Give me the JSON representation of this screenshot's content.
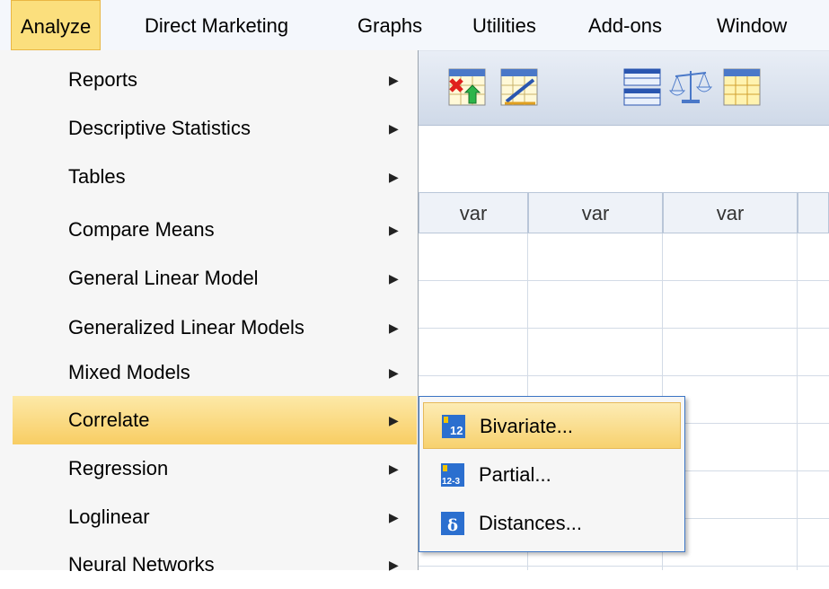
{
  "menubar": {
    "items": [
      {
        "label": "Analyze",
        "active": true
      },
      {
        "label": "Direct Marketing"
      },
      {
        "label": "Graphs"
      },
      {
        "label": "Utilities"
      },
      {
        "label": "Add-ons"
      },
      {
        "label": "Window"
      }
    ]
  },
  "grid": {
    "columns": [
      "var",
      "var",
      "var"
    ]
  },
  "analyze_menu": {
    "items": [
      {
        "label": "Reports"
      },
      {
        "label": "Descriptive Statistics"
      },
      {
        "label": "Tables"
      },
      {
        "label": "Compare Means"
      },
      {
        "label": "General Linear Model"
      },
      {
        "label": "Generalized Linear Models"
      },
      {
        "label": "Mixed Models"
      },
      {
        "label": "Correlate",
        "highlighted": true
      },
      {
        "label": "Regression"
      },
      {
        "label": "Loglinear"
      },
      {
        "label": "Neural Networks"
      }
    ],
    "arrow": "▶"
  },
  "correlate_submenu": {
    "items": [
      {
        "label": "Bivariate...",
        "icon": "bivariate-icon",
        "highlighted": true
      },
      {
        "label": "Partial...",
        "icon": "partial-icon"
      },
      {
        "label": "Distances...",
        "icon": "distances-icon"
      }
    ]
  },
  "colors": {
    "menu_highlight": "#f8cd63",
    "menubar_active": "#fbdf7d",
    "submenu_border": "#3c75c4",
    "icon_blue": "#2b6fcf"
  }
}
